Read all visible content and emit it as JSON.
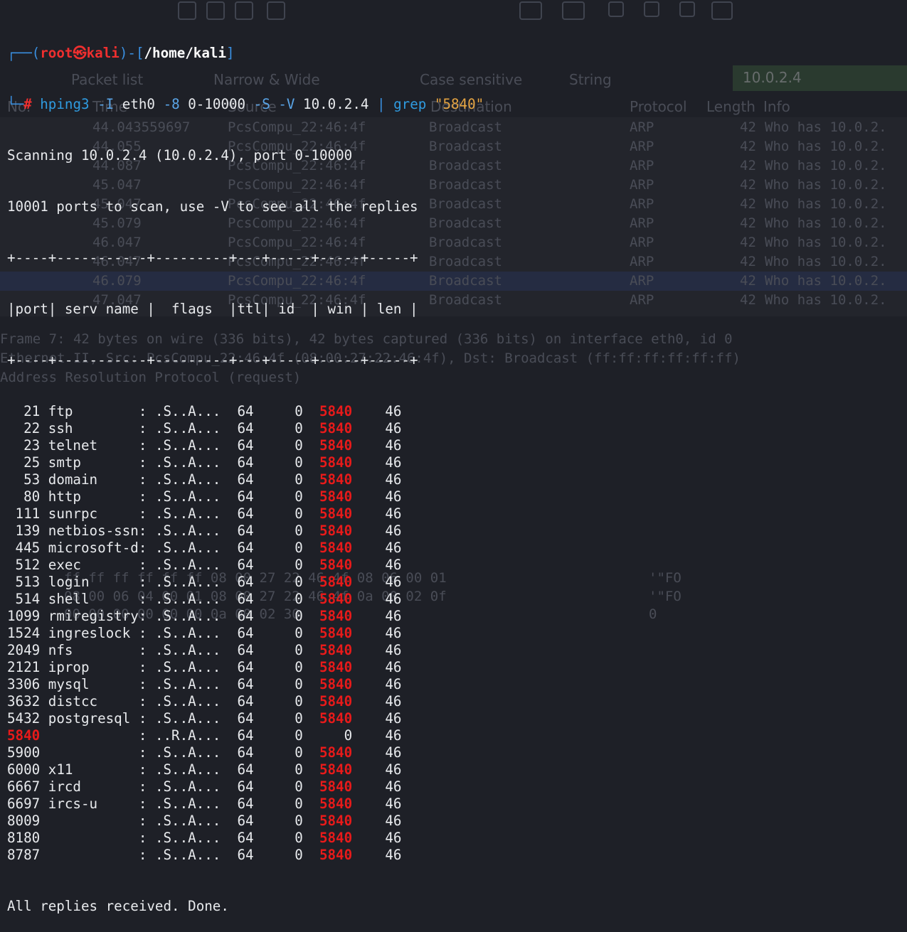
{
  "background_window": {
    "filter_options": [
      "Packet list",
      "Narrow & Wide",
      "Case sensitive",
      "String"
    ],
    "filter_value": "10.0.2.4",
    "columns": [
      "No.",
      "Time",
      "Source",
      "Destination",
      "Protocol",
      "Length",
      "Info"
    ],
    "packets": [
      {
        "time": "44.043559697",
        "source": "PcsCompu_22:46:4f",
        "destination": "Broadcast",
        "protocol": "ARP",
        "length": "42",
        "info": "Who has 10.0.2."
      },
      {
        "time": "44.055",
        "source": "PcsCompu_22:46:4f",
        "destination": "Broadcast",
        "protocol": "ARP",
        "length": "42",
        "info": "Who has 10.0.2."
      },
      {
        "time": "44.087",
        "source": "PcsCompu_22:46:4f",
        "destination": "Broadcast",
        "protocol": "ARP",
        "length": "42",
        "info": "Who has 10.0.2."
      },
      {
        "time": "45.047",
        "source": "PcsCompu_22:46:4f",
        "destination": "Broadcast",
        "protocol": "ARP",
        "length": "42",
        "info": "Who has 10.0.2."
      },
      {
        "time": "45.047",
        "source": "PcsCompu_22:46:4f",
        "destination": "Broadcast",
        "protocol": "ARP",
        "length": "42",
        "info": "Who has 10.0.2."
      },
      {
        "time": "45.079",
        "source": "PcsCompu_22:46:4f",
        "destination": "Broadcast",
        "protocol": "ARP",
        "length": "42",
        "info": "Who has 10.0.2."
      },
      {
        "time": "46.047",
        "source": "PcsCompu_22:46:4f",
        "destination": "Broadcast",
        "protocol": "ARP",
        "length": "42",
        "info": "Who has 10.0.2."
      },
      {
        "time": "46.047",
        "source": "PcsCompu_22:46:4f",
        "destination": "Broadcast",
        "protocol": "ARP",
        "length": "42",
        "info": "Who has 10.0.2."
      },
      {
        "time": "46.079",
        "source": "PcsCompu_22:46:4f",
        "destination": "Broadcast",
        "protocol": "ARP",
        "length": "42",
        "info": "Who has 10.0.2."
      },
      {
        "time": "47.047",
        "source": "PcsCompu_22:46:4f",
        "destination": "Broadcast",
        "protocol": "ARP",
        "length": "42",
        "info": "Who has 10.0.2."
      }
    ],
    "details": [
      "Frame 7: 42 bytes on wire (336 bits), 42 bytes captured (336 bits) on interface eth0, id 0",
      "Ethernet II, Src: PcsCompu_22:46:4f (08:00:27:22:46:4f), Dst: Broadcast (ff:ff:ff:ff:ff:ff)",
      "Address Resolution Protocol (request)"
    ],
    "hex_rows": [
      {
        "hex": "ff ff ff ff ff ff 08 00  27 22 46 4f 08 06 00 01",
        "ascii": "'\"FO"
      },
      {
        "hex": "08 00 06 04 00 01 08 00  27 22 46 4f 0a 00 02 0f",
        "ascii": "'\"FO"
      },
      {
        "hex": "00 00 00 00 00 00 0a 00  02 30",
        "ascii": "0"
      }
    ]
  },
  "terminal": {
    "prompt": {
      "corner_top": "┌──(",
      "user": "root",
      "at_symbol": "㉿",
      "host": "kali",
      "mid": ")-[",
      "path": "/home/kali",
      "close": "]",
      "corner_bottom": "└─",
      "hash": "#"
    },
    "command": {
      "program": "hping3",
      "args": [
        {
          "flag": "-I",
          "value": "eth0"
        },
        {
          "flag": "-8",
          "value": "0-10000"
        },
        {
          "flag": "-S",
          "value": ""
        },
        {
          "flag": "-V",
          "value": "10.0.2.4"
        }
      ],
      "pipe": "|",
      "grep": "grep",
      "pattern": "\"5840\""
    },
    "scan_line": "Scanning 10.0.2.4 (10.0.2.4), port 0-10000",
    "ports_line": "10001 ports to scan, use -V to see all the replies",
    "border_line": "+----+-----------+---------+---+-----+-----+-----+",
    "header_line": "|port| serv name |  flags  |ttl| id  | win | len |",
    "highlight": "5840",
    "rows": [
      {
        "port": "21",
        "serv": "ftp",
        "flags": ".S..A...",
        "ttl": "64",
        "id": "0",
        "win": "5840",
        "len": "46"
      },
      {
        "port": "22",
        "serv": "ssh",
        "flags": ".S..A...",
        "ttl": "64",
        "id": "0",
        "win": "5840",
        "len": "46"
      },
      {
        "port": "23",
        "serv": "telnet",
        "flags": ".S..A...",
        "ttl": "64",
        "id": "0",
        "win": "5840",
        "len": "46"
      },
      {
        "port": "25",
        "serv": "smtp",
        "flags": ".S..A...",
        "ttl": "64",
        "id": "0",
        "win": "5840",
        "len": "46"
      },
      {
        "port": "53",
        "serv": "domain",
        "flags": ".S..A...",
        "ttl": "64",
        "id": "0",
        "win": "5840",
        "len": "46"
      },
      {
        "port": "80",
        "serv": "http",
        "flags": ".S..A...",
        "ttl": "64",
        "id": "0",
        "win": "5840",
        "len": "46"
      },
      {
        "port": "111",
        "serv": "sunrpc",
        "flags": ".S..A...",
        "ttl": "64",
        "id": "0",
        "win": "5840",
        "len": "46"
      },
      {
        "port": "139",
        "serv": "netbios-ssn",
        "flags": ".S..A...",
        "ttl": "64",
        "id": "0",
        "win": "5840",
        "len": "46"
      },
      {
        "port": "445",
        "serv": "microsoft-d",
        "flags": ".S..A...",
        "ttl": "64",
        "id": "0",
        "win": "5840",
        "len": "46"
      },
      {
        "port": "512",
        "serv": "exec",
        "flags": ".S..A...",
        "ttl": "64",
        "id": "0",
        "win": "5840",
        "len": "46"
      },
      {
        "port": "513",
        "serv": "login",
        "flags": ".S..A...",
        "ttl": "64",
        "id": "0",
        "win": "5840",
        "len": "46"
      },
      {
        "port": "514",
        "serv": "shell",
        "flags": ".S..A...",
        "ttl": "64",
        "id": "0",
        "win": "5840",
        "len": "46"
      },
      {
        "port": "1099",
        "serv": "rmiregistry",
        "flags": ".S..A...",
        "ttl": "64",
        "id": "0",
        "win": "5840",
        "len": "46"
      },
      {
        "port": "1524",
        "serv": "ingreslock",
        "flags": ".S..A...",
        "ttl": "64",
        "id": "0",
        "win": "5840",
        "len": "46"
      },
      {
        "port": "2049",
        "serv": "nfs",
        "flags": ".S..A...",
        "ttl": "64",
        "id": "0",
        "win": "5840",
        "len": "46"
      },
      {
        "port": "2121",
        "serv": "iprop",
        "flags": ".S..A...",
        "ttl": "64",
        "id": "0",
        "win": "5840",
        "len": "46"
      },
      {
        "port": "3306",
        "serv": "mysql",
        "flags": ".S..A...",
        "ttl": "64",
        "id": "0",
        "win": "5840",
        "len": "46"
      },
      {
        "port": "3632",
        "serv": "distcc",
        "flags": ".S..A...",
        "ttl": "64",
        "id": "0",
        "win": "5840",
        "len": "46"
      },
      {
        "port": "5432",
        "serv": "postgresql",
        "flags": ".S..A...",
        "ttl": "64",
        "id": "0",
        "win": "5840",
        "len": "46"
      },
      {
        "port": "5840",
        "serv": "",
        "flags": "..R.A...",
        "ttl": "64",
        "id": "0",
        "win": "0",
        "len": "46"
      },
      {
        "port": "5900",
        "serv": "",
        "flags": ".S..A...",
        "ttl": "64",
        "id": "0",
        "win": "5840",
        "len": "46"
      },
      {
        "port": "6000",
        "serv": "x11",
        "flags": ".S..A...",
        "ttl": "64",
        "id": "0",
        "win": "5840",
        "len": "46"
      },
      {
        "port": "6667",
        "serv": "ircd",
        "flags": ".S..A...",
        "ttl": "64",
        "id": "0",
        "win": "5840",
        "len": "46"
      },
      {
        "port": "6697",
        "serv": "ircs-u",
        "flags": ".S..A...",
        "ttl": "64",
        "id": "0",
        "win": "5840",
        "len": "46"
      },
      {
        "port": "8009",
        "serv": "",
        "flags": ".S..A...",
        "ttl": "64",
        "id": "0",
        "win": "5840",
        "len": "46"
      },
      {
        "port": "8180",
        "serv": "",
        "flags": ".S..A...",
        "ttl": "64",
        "id": "0",
        "win": "5840",
        "len": "46"
      },
      {
        "port": "8787",
        "serv": "",
        "flags": ".S..A...",
        "ttl": "64",
        "id": "0",
        "win": "5840",
        "len": "46"
      }
    ],
    "done_line": "All replies received. Done."
  },
  "colors": {
    "background": "#1e2027",
    "prompt_blue": "#3a8fe0",
    "prompt_red": "#ef2f2f",
    "highlight_red": "#e81a1a",
    "string_orange": "#e5a442",
    "selected_row": "#2f3c63"
  }
}
